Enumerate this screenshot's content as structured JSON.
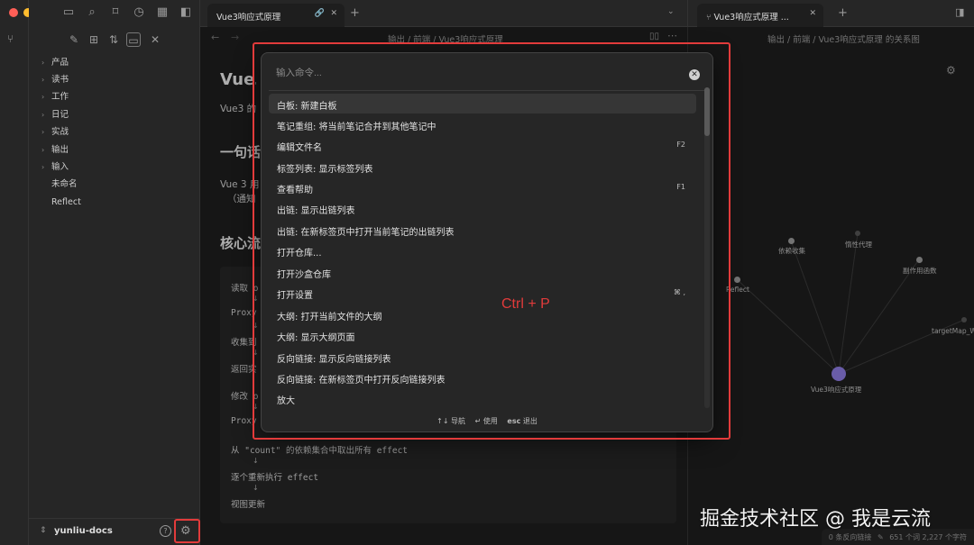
{
  "window": {
    "traffic_colors": {
      "close": "#ff5f57",
      "minimize": "#febc2e",
      "maximize": "#28c840"
    }
  },
  "sidebar": {
    "tree": [
      {
        "label": "产品",
        "folder": true
      },
      {
        "label": "读书",
        "folder": true
      },
      {
        "label": "工作",
        "folder": true
      },
      {
        "label": "日记",
        "folder": true
      },
      {
        "label": "实战",
        "folder": true
      },
      {
        "label": "输出",
        "folder": true
      },
      {
        "label": "输入",
        "folder": true
      },
      {
        "label": "未命名",
        "folder": false
      },
      {
        "label": "Reflect",
        "folder": false
      }
    ],
    "vault_name": "yunliu-docs"
  },
  "editor": {
    "tab_title": "Vue3响应式原理",
    "breadcrumb": [
      "输出",
      "前端",
      "Vue3响应式原理"
    ],
    "title": "Vue3",
    "intro": "Vue3 的",
    "h2_1": "一句话",
    "body_1": "Vue 3 用",
    "body_2": "（通知",
    "h2_2": "核心流",
    "code_lines": [
      {
        "text": "读取 o",
        "arrow": true
      },
      {
        "text": "Proxy",
        "arrow": true
      },
      {
        "text": "收集到",
        "arrow": true
      },
      {
        "text": "返回实",
        "arrow": false
      },
      {
        "text": "修改 o",
        "arrow": true
      },
      {
        "text": "Proxy",
        "arrow": false
      },
      {
        "text": "从 \"count\" 的依赖集合中取出所有 effect",
        "arrow": true
      },
      {
        "text": "逐个重新执行 effect",
        "arrow": true
      },
      {
        "text": "视图更新",
        "arrow": false
      }
    ]
  },
  "graph": {
    "tab_title": "Vue3响应式原理 ...",
    "breadcrumb": [
      "输出",
      "前端",
      "Vue3响应式原理 的关系图"
    ],
    "nodes": [
      {
        "label": "依赖收集"
      },
      {
        "label": "惰性代理"
      },
      {
        "label": "副作用函数"
      },
      {
        "label": "Reflect"
      },
      {
        "label": "targetMap_We"
      },
      {
        "label": "Vue3响应式原理"
      }
    ]
  },
  "palette": {
    "placeholder": "输入命令...",
    "commands": [
      {
        "label": "白板: 新建白板",
        "hotkey": "",
        "selected": true
      },
      {
        "label": "笔记重组: 将当前笔记合并到其他笔记中",
        "hotkey": ""
      },
      {
        "label": "编辑文件名",
        "hotkey": "F2"
      },
      {
        "label": "标签列表: 显示标签列表",
        "hotkey": ""
      },
      {
        "label": "查看帮助",
        "hotkey": "F1"
      },
      {
        "label": "出链: 显示出链列表",
        "hotkey": ""
      },
      {
        "label": "出链: 在新标签页中打开当前笔记的出链列表",
        "hotkey": ""
      },
      {
        "label": "打开仓库...",
        "hotkey": ""
      },
      {
        "label": "打开沙盒仓库",
        "hotkey": ""
      },
      {
        "label": "打开设置",
        "hotkey": "⌘ ,"
      },
      {
        "label": "大纲: 打开当前文件的大纲",
        "hotkey": ""
      },
      {
        "label": "大纲: 显示大纲页面",
        "hotkey": ""
      },
      {
        "label": "反向链接: 显示反向链接列表",
        "hotkey": ""
      },
      {
        "label": "反向链接: 在新标签页中打开反向链接列表",
        "hotkey": ""
      },
      {
        "label": "放大",
        "hotkey": ""
      }
    ],
    "footer": {
      "navigate": "↑↓ 导航",
      "use": "↵ 使用",
      "exit_key": "esc",
      "exit_label": "退出"
    }
  },
  "annotation": {
    "shortcut": "Ctrl + P",
    "color": "#e23b3b"
  },
  "status": {
    "backlinks": "0 条反向链接",
    "words": "651 个词",
    "chars": "2,227 个字符"
  },
  "watermark": "掘金技术社区 @ 我是云流"
}
